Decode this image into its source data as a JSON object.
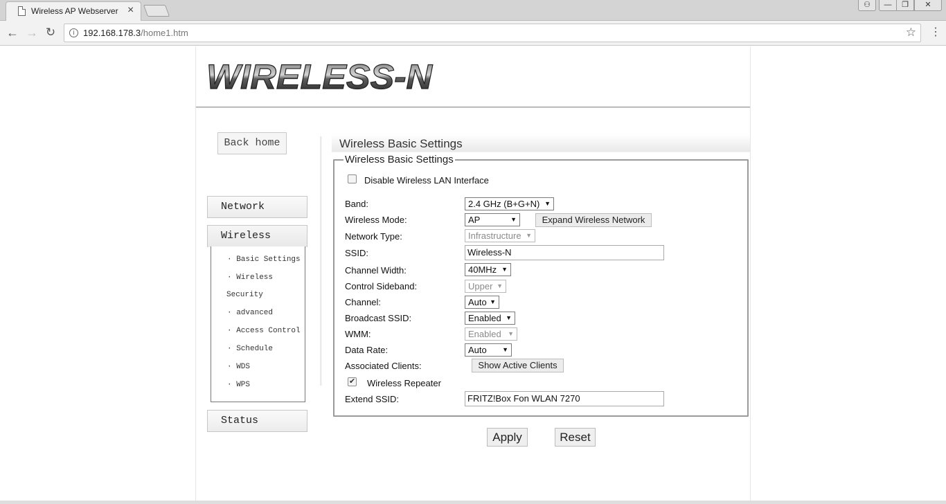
{
  "browser": {
    "tab_title": "Wireless AP Webserver",
    "tab_close": "×",
    "url_host": "192.168.178.3",
    "url_path": "/home1.htm",
    "back": "←",
    "forward": "→",
    "reload": "↻",
    "star": "☆",
    "menu": "⋮",
    "win_min": "—",
    "win_max": "❐",
    "win_close": "✕",
    "win_user": "⚇"
  },
  "header": {
    "logo_text": "WIRELESS-N"
  },
  "sidebar": {
    "back_home": "Back home",
    "network": "Network",
    "wireless": "Wireless",
    "status": "Status",
    "wireless_items": [
      "· Basic Settings",
      "· Wireless",
      "Security",
      "· advanced",
      "· Access Control",
      "· Schedule",
      "· WDS",
      "· WPS"
    ]
  },
  "main": {
    "section_title": "Wireless Basic Settings",
    "legend": "Wireless Basic Settings",
    "disable_wlan_label": "Disable Wireless LAN Interface",
    "disable_wlan_checked": false,
    "band_label": "Band:",
    "band_value": "2.4 GHz (B+G+N)",
    "mode_label": "Wireless Mode:",
    "mode_value": "AP",
    "expand_button": "Expand Wireless Network",
    "nettype_label": "Network Type:",
    "nettype_value": "Infrastructure",
    "ssid_label": "SSID:",
    "ssid_value": "Wireless-N",
    "chwidth_label": "Channel Width:",
    "chwidth_value": "40MHz",
    "sideband_label": "Control Sideband:",
    "sideband_value": "Upper",
    "channel_label": "Channel:",
    "channel_value": "Auto",
    "broadcast_label": "Broadcast SSID:",
    "broadcast_value": "Enabled",
    "wmm_label": "WMM:",
    "wmm_value": "Enabled",
    "datarate_label": "Data Rate:",
    "datarate_value": "Auto",
    "clients_label": "Associated Clients:",
    "clients_button": "Show Active Clients",
    "repeater_label": "Wireless Repeater",
    "repeater_checked": true,
    "extend_ssid_label": "Extend SSID:",
    "extend_ssid_value": "FRITZ!Box Fon WLAN 7270",
    "apply": "Apply",
    "reset": "Reset"
  }
}
